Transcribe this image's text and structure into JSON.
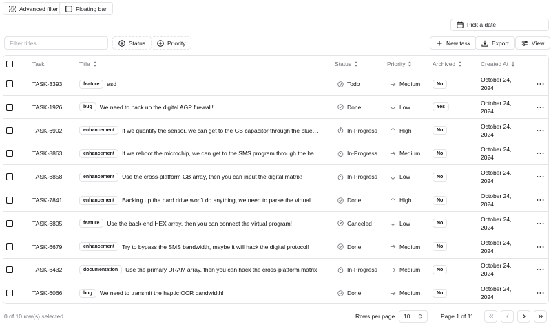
{
  "toolbar": {
    "advanced_filter": "Advanced filter",
    "floating_bar": "Floating bar",
    "pick_date": "Pick a date",
    "filter_placeholder": "Filter titles...",
    "status": "Status",
    "priority": "Priority",
    "new_task": "New task",
    "export": "Export",
    "view": "View"
  },
  "columns": {
    "task": "Task",
    "title": "Title",
    "status": "Status",
    "priority": "Priority",
    "archived": "Archived",
    "created": "Created At"
  },
  "rows": [
    {
      "id": "TASK-3393",
      "label": "feature",
      "title": "asd",
      "status": "Todo",
      "status_icon": "help-circle-icon",
      "priority": "Medium",
      "priority_icon": "arrow-right-icon",
      "archived": "No",
      "created_1": "October 24,",
      "created_2": "2024"
    },
    {
      "id": "TASK-1926",
      "label": "bug",
      "title": "We need to back up the digital AGP firewall!",
      "status": "Done",
      "status_icon": "check-circle-icon",
      "priority": "Low",
      "priority_icon": "arrow-down-icon",
      "archived": "Yes",
      "created_1": "October 24,",
      "created_2": "2024"
    },
    {
      "id": "TASK-6902",
      "label": "enhancement",
      "title": "If we quantify the sensor, we can get to the GB capacitor through the blue…",
      "status": "In-Progress",
      "status_icon": "timer-icon",
      "priority": "High",
      "priority_icon": "arrow-up-icon",
      "archived": "No",
      "created_1": "October 24,",
      "created_2": "2024"
    },
    {
      "id": "TASK-8863",
      "label": "enhancement",
      "title": "If we reboot the microchip, we can get to the SMS program through the ha…",
      "status": "In-Progress",
      "status_icon": "timer-icon",
      "priority": "Medium",
      "priority_icon": "arrow-right-icon",
      "archived": "No",
      "created_1": "October 24,",
      "created_2": "2024"
    },
    {
      "id": "TASK-6858",
      "label": "enhancement",
      "title": "Use the cross-platform GB array, then you can input the digital matrix!",
      "status": "In-Progress",
      "status_icon": "timer-icon",
      "priority": "Low",
      "priority_icon": "arrow-down-icon",
      "archived": "No",
      "created_1": "October 24,",
      "created_2": "2024"
    },
    {
      "id": "TASK-7841",
      "label": "enhancement",
      "title": "Backing up the hard drive won't do anything, we need to parse the virtual …",
      "status": "Done",
      "status_icon": "check-circle-icon",
      "priority": "High",
      "priority_icon": "arrow-up-icon",
      "archived": "No",
      "created_1": "October 24,",
      "created_2": "2024"
    },
    {
      "id": "TASK-6805",
      "label": "feature",
      "title": "Use the back-end HEX array, then you can connect the virtual program!",
      "status": "Canceled",
      "status_icon": "x-circle-icon",
      "priority": "Low",
      "priority_icon": "arrow-down-icon",
      "archived": "No",
      "created_1": "October 24,",
      "created_2": "2024"
    },
    {
      "id": "TASK-6679",
      "label": "enhancement",
      "title": "Try to bypass the SMS bandwidth, maybe it will hack the digital protocol!",
      "status": "Done",
      "status_icon": "check-circle-icon",
      "priority": "Medium",
      "priority_icon": "arrow-right-icon",
      "archived": "No",
      "created_1": "October 24,",
      "created_2": "2024"
    },
    {
      "id": "TASK-6432",
      "label": "documentation",
      "title": "Use the primary DRAM array, then you can hack the cross-platform matrix!",
      "status": "In-Progress",
      "status_icon": "timer-icon",
      "priority": "Medium",
      "priority_icon": "arrow-right-icon",
      "archived": "No",
      "created_1": "October 24,",
      "created_2": "2024"
    },
    {
      "id": "TASK-6066",
      "label": "bug",
      "title": "We need to transmit the haptic OCR bandwidth!",
      "status": "Done",
      "status_icon": "check-circle-icon",
      "priority": "Medium",
      "priority_icon": "arrow-right-icon",
      "archived": "No",
      "created_1": "October 24,",
      "created_2": "2024"
    }
  ],
  "footer": {
    "selected": "0 of 10 row(s) selected.",
    "rows_per_page": "Rows per page",
    "page_size": "10",
    "page_info": "Page 1 of 11"
  }
}
